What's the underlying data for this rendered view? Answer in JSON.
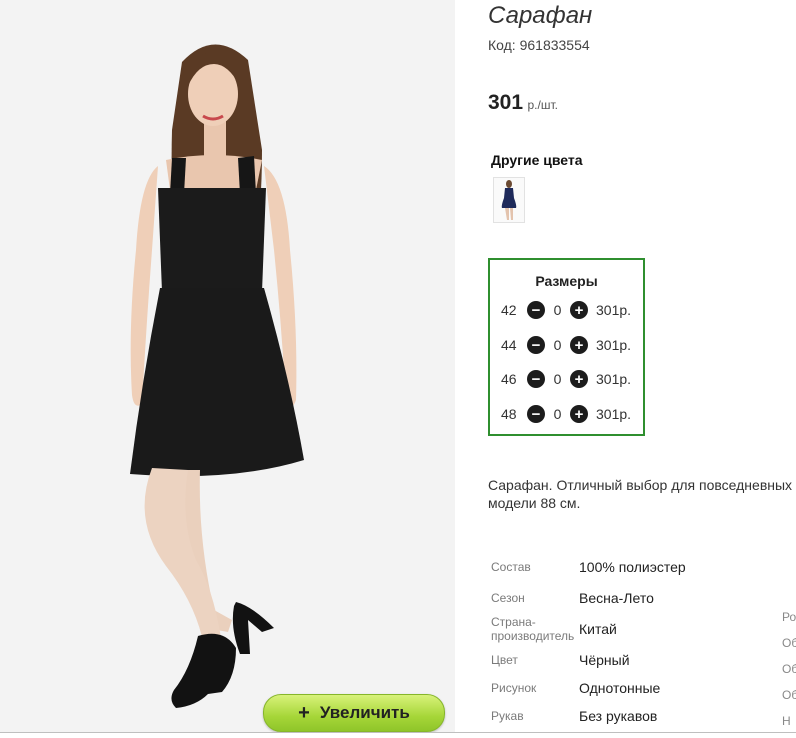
{
  "product": {
    "title": "Сарафан",
    "code_label": "Код:",
    "code": "961833554",
    "price": "301",
    "price_unit": "р./шт."
  },
  "gallery": {
    "zoom_label": "Увеличить",
    "zoom_icon": "plus-icon"
  },
  "other_colors": {
    "title": "Другие цвета",
    "swatches": [
      {
        "color": "navy",
        "accent": "#1e2a5a"
      }
    ]
  },
  "sizes": {
    "title": "Размеры",
    "rows": [
      {
        "size": "42",
        "qty": "0",
        "price": "301р."
      },
      {
        "size": "44",
        "qty": "0",
        "price": "301р."
      },
      {
        "size": "46",
        "qty": "0",
        "price": "301р."
      },
      {
        "size": "48",
        "qty": "0",
        "price": "301р."
      }
    ],
    "minus_icon": "minus-circle-icon",
    "plus_icon": "plus-circle-icon"
  },
  "description": {
    "line1": "Сарафан. Отличный выбор для повседневных",
    "line2": "модели 88 см."
  },
  "specs": [
    {
      "key": "Состав",
      "value": "100% полиэстер"
    },
    {
      "key": "Сезон",
      "value": "Весна-Лето"
    },
    {
      "key": "Страна-производитель",
      "value": "Китай"
    },
    {
      "key": "Цвет",
      "value": "Чёрный"
    },
    {
      "key": "Рисунок",
      "value": "Однотонные"
    },
    {
      "key": "Рукав",
      "value": "Без рукавов"
    }
  ],
  "right_edge_labels": [
    "Ро",
    "Об",
    "Об",
    "Об",
    "Н"
  ],
  "colors": {
    "accent_green": "#2f8f2f",
    "zoom_button": "#a6d638",
    "dress": "#1a1a1a"
  }
}
